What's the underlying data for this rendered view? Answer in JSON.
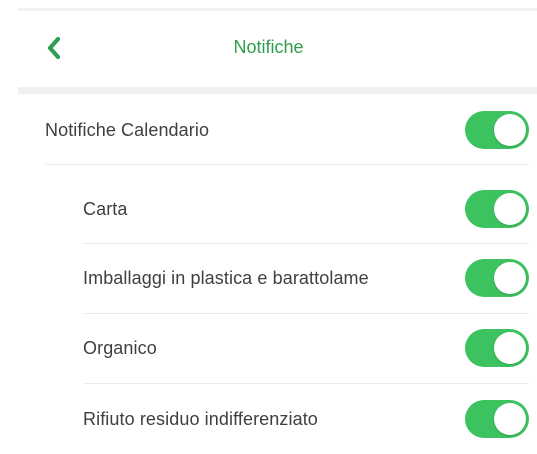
{
  "header": {
    "title": "Notifiche",
    "back_icon": "chevron-left-icon"
  },
  "accent_color": "#2e9e4f",
  "toggle_on_color": "#3cc35f",
  "settings": {
    "main": {
      "label": "Notifiche Calendario",
      "enabled": true
    },
    "items": [
      {
        "label": "Carta",
        "enabled": true
      },
      {
        "label": "Imballaggi in plastica e barattolame",
        "enabled": true
      },
      {
        "label": "Organico",
        "enabled": true
      },
      {
        "label": "Rifiuto residuo indifferenziato",
        "enabled": true
      }
    ]
  }
}
